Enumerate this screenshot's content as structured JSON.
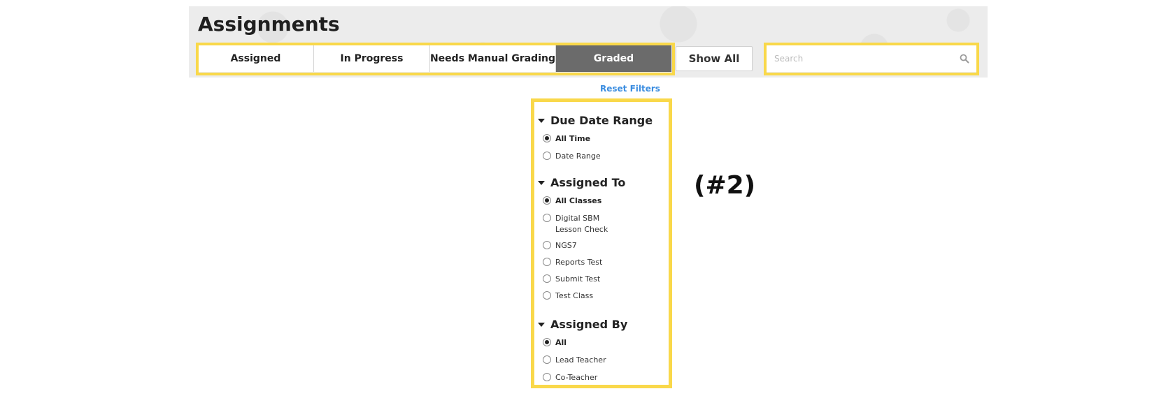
{
  "page": {
    "title": "Assignments"
  },
  "status_tabs": [
    {
      "label": "Assigned",
      "active": false
    },
    {
      "label": "In Progress",
      "active": false
    },
    {
      "label": "Needs Manual Grading",
      "active": false
    },
    {
      "label": "Graded",
      "active": true
    }
  ],
  "show_all_label": "Show All",
  "search": {
    "placeholder": "Search",
    "value": "",
    "icon": "search-icon"
  },
  "reset_filters_label": "Reset Filters",
  "filters": {
    "due_date_range": {
      "title": "Due Date Range",
      "options": [
        {
          "label": "All Time",
          "checked": true
        },
        {
          "label": "Date Range",
          "checked": false
        }
      ]
    },
    "assigned_to": {
      "title": "Assigned To",
      "options": [
        {
          "label": "All Classes",
          "checked": true
        },
        {
          "label": "Digital SBM Lesson Check",
          "checked": false
        },
        {
          "label": "NGS7",
          "checked": false
        },
        {
          "label": "Reports Test",
          "checked": false
        },
        {
          "label": "Submit Test",
          "checked": false
        },
        {
          "label": "Test Class",
          "checked": false
        }
      ]
    },
    "assigned_by": {
      "title": "Assigned By",
      "options": [
        {
          "label": "All",
          "checked": true
        },
        {
          "label": "Lead Teacher",
          "checked": false
        },
        {
          "label": "Co-Teacher",
          "checked": false
        }
      ]
    }
  },
  "annotation_label": "(#2)",
  "colors": {
    "highlight": "#f9d84a",
    "active_tab": "#6b6b6b",
    "link": "#3b8de0",
    "header_background": "#ececec"
  }
}
